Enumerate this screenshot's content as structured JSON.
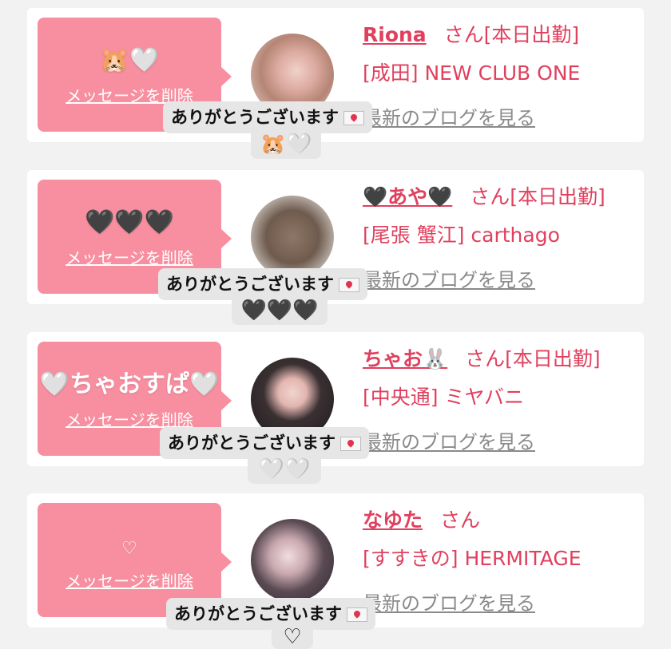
{
  "cards": [
    {
      "message": "🐹🤍",
      "delete_label": "メッセージを削除",
      "name": "Riona",
      "suffix": "さん[本日出勤]",
      "shop": "[成田] NEW CLUB ONE",
      "blog_link": "最新のブログを見る",
      "popup_text": "ありがとうございます",
      "popup_emoji": "🐹🤍"
    },
    {
      "message": "🖤🖤🖤",
      "delete_label": "メッセージを削除",
      "name": "🖤あや🖤",
      "suffix": "さん[本日出勤]",
      "shop": "[尾張 蟹江] carthago",
      "blog_link": "最新のブログを見る",
      "popup_text": "ありがとうございます",
      "popup_emoji": "🖤🖤🖤"
    },
    {
      "message": "🤍ちゃおすぱ🤍",
      "delete_label": "メッセージを削除",
      "name": "ちゃお🐰",
      "suffix": "さん[本日出勤]",
      "shop": "[中央通] ミヤバニ",
      "blog_link": "最新のブログを見る",
      "popup_text": "ありがとうございます",
      "popup_emoji": "🤍🤍"
    },
    {
      "message": "♡",
      "delete_label": "メッセージを削除",
      "name": "なゆた",
      "suffix": "さん",
      "shop": "[すすきの] HERMITAGE",
      "blog_link": "最新のブログを見る",
      "popup_text": "ありがとうございます",
      "popup_emoji": "♡"
    }
  ],
  "colors": {
    "bubble": "#f88fa0",
    "accent": "#e0405e",
    "link_gray": "#8a8a8a",
    "background": "#f2f2f2"
  }
}
